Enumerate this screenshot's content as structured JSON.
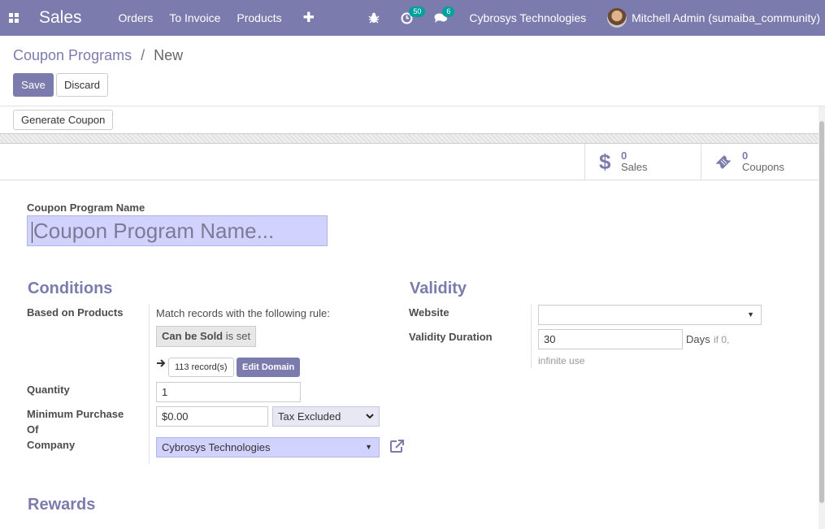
{
  "navbar": {
    "app_name": "Sales",
    "menu": [
      "Orders",
      "To Invoice",
      "Products"
    ],
    "activity_count": "50",
    "message_count": "6",
    "company": "Cybrosys Technologies",
    "user": "Mitchell Admin (sumaiba_community)"
  },
  "breadcrumb": {
    "parent": "Coupon Programs",
    "separator": "/",
    "current": "New"
  },
  "actions": {
    "save": "Save",
    "discard": "Discard"
  },
  "statusbar": {
    "generate": "Generate Coupon"
  },
  "smart_buttons": [
    {
      "count": "0",
      "label": "Sales"
    },
    {
      "count": "0",
      "label": "Coupons"
    }
  ],
  "form": {
    "name_label": "Coupon Program Name",
    "name_placeholder": "Coupon Program Name...",
    "conditions_title": "Conditions",
    "based_on_products_label": "Based on Products",
    "match_text": "Match records with the following rule:",
    "domain_field": "Can be Sold",
    "domain_op": "is set",
    "records_count": "113 record(s)",
    "edit_domain": "Edit Domain",
    "quantity_label": "Quantity",
    "quantity_value": "1",
    "min_purchase_label_1": "Minimum Purchase",
    "min_purchase_label_2": "Of",
    "min_purchase_value": "$0.00",
    "tax_option": "Tax Excluded",
    "company_label": "Company",
    "company_value": "Cybrosys Technologies",
    "validity_title": "Validity",
    "website_label": "Website",
    "website_value": "",
    "validity_duration_label": "Validity Duration",
    "validity_duration_value": "30",
    "days_label": "Days",
    "hint_1": "if 0,",
    "hint_2": "infinite use",
    "rewards_title": "Rewards"
  },
  "colors": {
    "brand": "#7c7bad",
    "badge": "#00a09d",
    "required_bg": "#d2d2ff"
  }
}
